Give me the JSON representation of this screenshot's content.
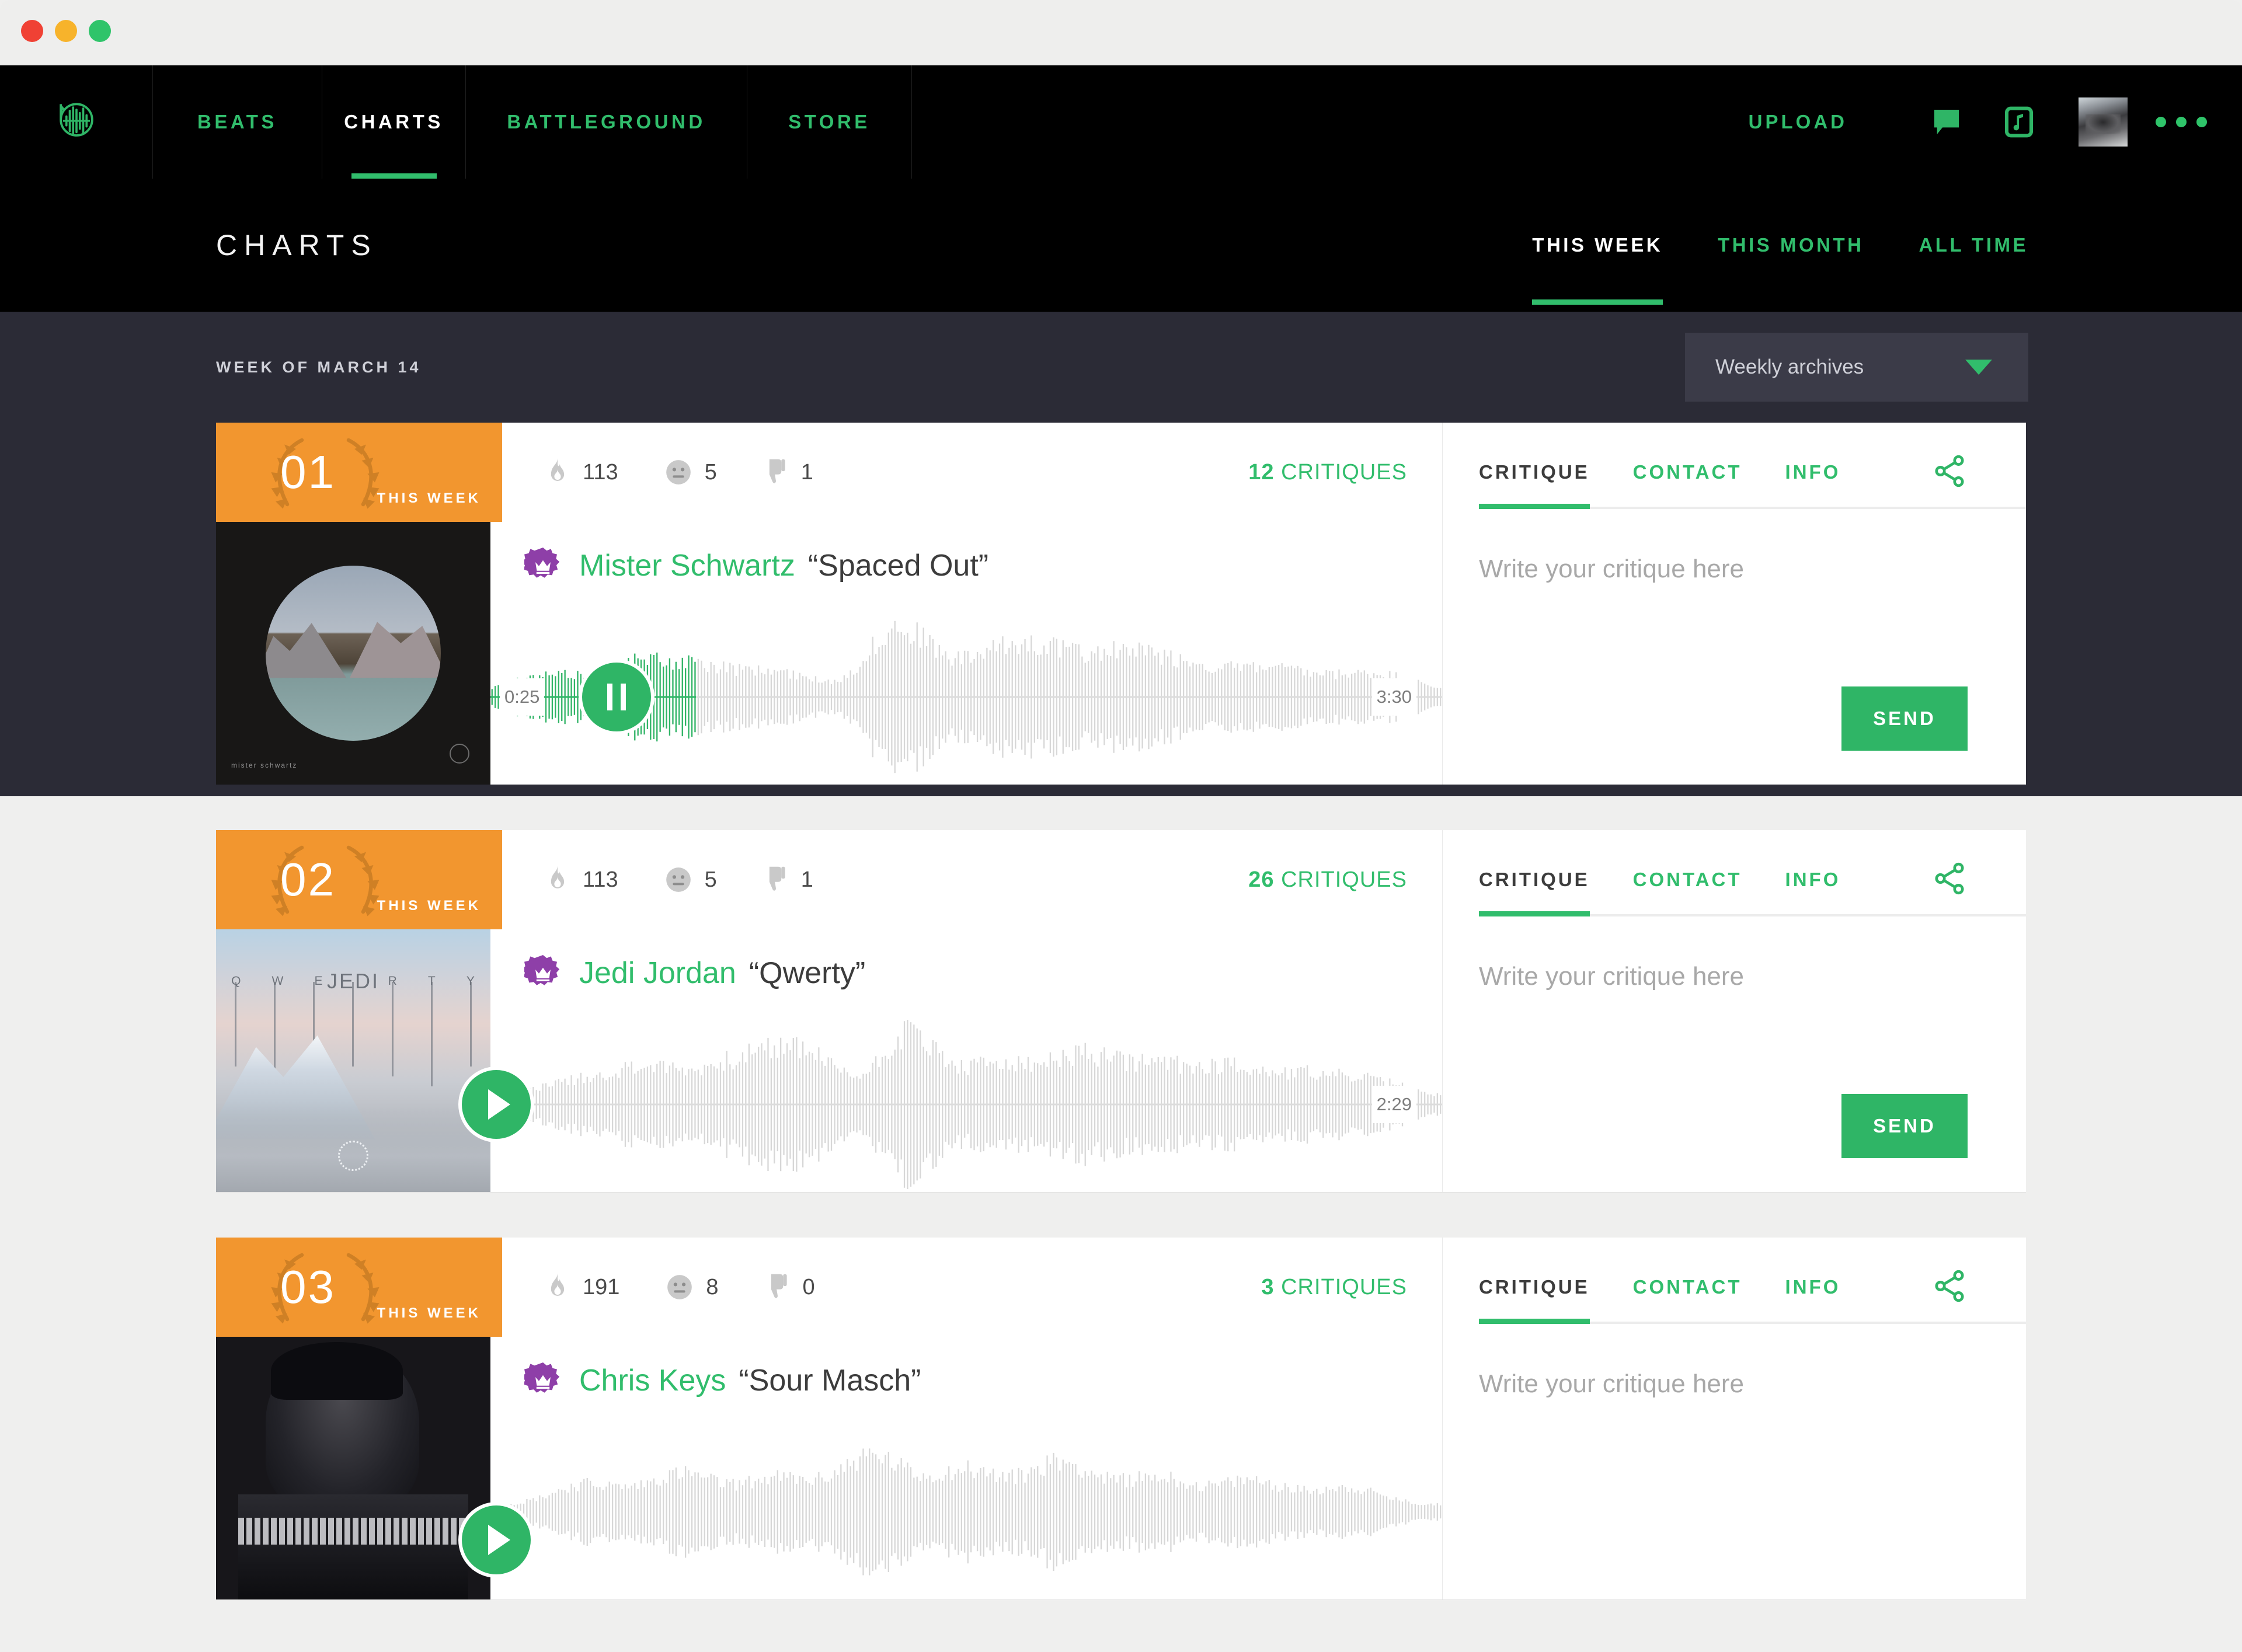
{
  "window": {
    "traffic_lights": [
      "close",
      "minimize",
      "maximize"
    ]
  },
  "nav": {
    "logo_name": "beat-waveform-logo",
    "tabs": [
      {
        "label": "BEATS",
        "active": false
      },
      {
        "label": "CHARTS",
        "active": true
      },
      {
        "label": "BATTLEGROUND",
        "active": false
      },
      {
        "label": "STORE",
        "active": false
      }
    ],
    "upload_label": "UPLOAD",
    "icons": [
      "message-icon",
      "music-note-icon"
    ],
    "avatar_name": "user-avatar",
    "more_label": "more-options-icon"
  },
  "header": {
    "title": "CHARTS",
    "range_tabs": [
      {
        "label": "THIS WEEK",
        "active": true
      },
      {
        "label": "THIS MONTH",
        "active": false
      },
      {
        "label": "ALL TIME",
        "active": false
      }
    ]
  },
  "subbar": {
    "week_label": "WEEK OF MARCH 14",
    "archives_value": "Weekly archives"
  },
  "colors": {
    "accent_green": "#31bd6c",
    "rank_orange": "#f2962f",
    "crown_purple": "#8e3fa8",
    "dark_band": "#2b2b36",
    "nav_black": "#000000"
  },
  "panel_defaults": {
    "tabs": [
      "CRITIQUE",
      "CONTACT",
      "INFO"
    ],
    "active_tab": "CRITIQUE",
    "share_icon": "share-icon",
    "input_placeholder": "Write your critique here",
    "send_label": "SEND"
  },
  "cards": [
    {
      "rank": "01",
      "rank_sub": "THIS WEEK",
      "stats": {
        "fire": "113",
        "neutral": "5",
        "thumbs_down": "1"
      },
      "critiques_count": "12",
      "critiques_label": "CRITIQUES",
      "artist": "Mister Schwartz",
      "song": "“Spaced Out”",
      "verified": true,
      "time_current": "0:25",
      "time_total": "3:30",
      "playing": true,
      "progress_percent": 22,
      "art_name": "album-art-mountain-lake"
    },
    {
      "rank": "02",
      "rank_sub": "THIS WEEK",
      "stats": {
        "fire": "113",
        "neutral": "5",
        "thumbs_down": "1"
      },
      "critiques_count": "26",
      "critiques_label": "CRITIQUES",
      "artist": "Jedi Jordan",
      "song": "“Qwerty”",
      "verified": true,
      "time_current": "",
      "time_total": "2:29",
      "playing": false,
      "progress_percent": 0,
      "art_name": "album-art-qwerty-mountain"
    },
    {
      "rank": "03",
      "rank_sub": "THIS WEEK",
      "stats": {
        "fire": "191",
        "neutral": "8",
        "thumbs_down": "0"
      },
      "critiques_count": "3",
      "critiques_label": "CRITIQUES",
      "artist": "Chris Keys",
      "song": "“Sour Masch”",
      "verified": true,
      "time_current": "",
      "time_total": "",
      "playing": false,
      "progress_percent": 0,
      "art_name": "album-art-keyboard-player"
    }
  ]
}
